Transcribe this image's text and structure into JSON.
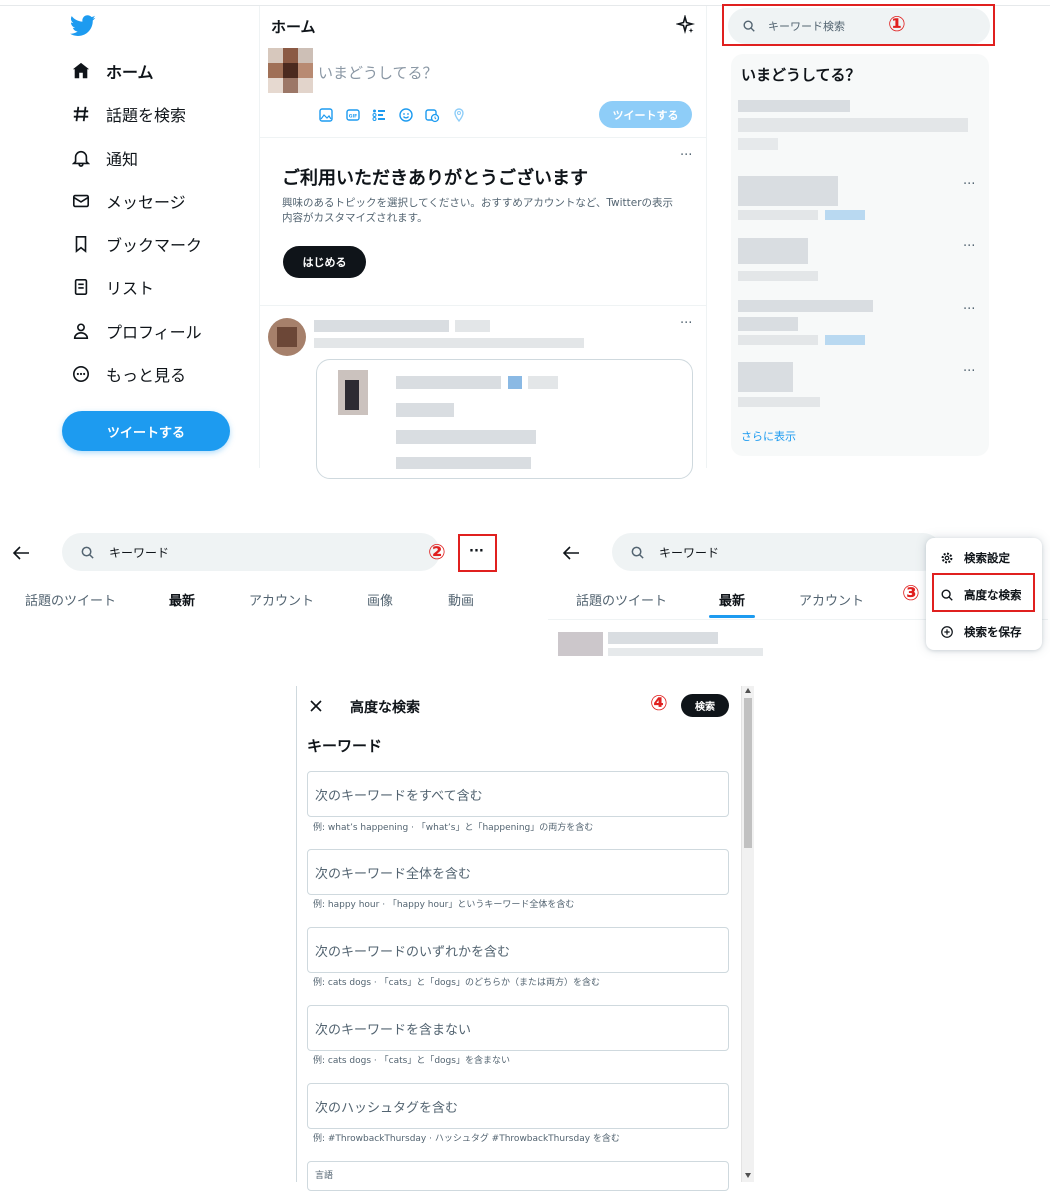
{
  "app": {
    "logo_icon": "twitter-bird-icon",
    "accent_color": "#1d9bf0",
    "annotation_color": "#e0201f"
  },
  "sidebar": {
    "items": [
      {
        "label": "ホーム",
        "icon": "home-icon",
        "active": true
      },
      {
        "label": "話題を検索",
        "icon": "hashtag-icon",
        "active": false
      },
      {
        "label": "通知",
        "icon": "bell-icon",
        "active": false
      },
      {
        "label": "メッセージ",
        "icon": "envelope-icon",
        "active": false
      },
      {
        "label": "ブックマーク",
        "icon": "bookmark-icon",
        "active": false
      },
      {
        "label": "リスト",
        "icon": "list-icon",
        "active": false
      },
      {
        "label": "プロフィール",
        "icon": "person-icon",
        "active": false
      },
      {
        "label": "もっと見る",
        "icon": "more-circle-icon",
        "active": false
      }
    ],
    "tweet_button": "ツイートする"
  },
  "home": {
    "title": "ホーム",
    "compose_placeholder": "いまどうしてる？",
    "compose_button": "ツイートする",
    "compose_tools": [
      "image-icon",
      "gif-icon",
      "poll-icon",
      "emoji-icon",
      "schedule-icon",
      "location-icon"
    ],
    "welcome": {
      "title": "ご利用いただきありがとうございます",
      "description": "興味のあるトピックを選択してください。おすすめアカウントなど、Twitterの表示内容がカスタマイズされます。",
      "button": "はじめる"
    }
  },
  "right_panel": {
    "search_placeholder": "キーワード検索",
    "trends_title": "いまどうしてる？",
    "show_more": "さらに表示"
  },
  "annotations": {
    "step1": "①",
    "step2": "②",
    "step3": "③",
    "step4": "④"
  },
  "search_results": {
    "query": "キーワード",
    "tabs": [
      "話題のツイート",
      "最新",
      "アカウント",
      "画像",
      "動画"
    ],
    "active_tab": "最新",
    "menu": [
      {
        "label": "検索設定",
        "icon": "gear-icon"
      },
      {
        "label": "高度な検索",
        "icon": "search-icon"
      },
      {
        "label": "検索を保存",
        "icon": "plus-circle-icon"
      }
    ]
  },
  "advanced_search": {
    "title": "高度な検索",
    "search_button": "検索",
    "section_heading": "キーワード",
    "fields": [
      {
        "placeholder": "次のキーワードをすべて含む",
        "hint": "例: what’s happening · 「what’s」と「happening」の両方を含む"
      },
      {
        "placeholder": "次のキーワード全体を含む",
        "hint": "例: happy hour · 「happy hour」というキーワード全体を含む"
      },
      {
        "placeholder": "次のキーワードのいずれかを含む",
        "hint": "例: cats dogs · 「cats」と「dogs」のどちらか（または両方）を含む"
      },
      {
        "placeholder": "次のキーワードを含まない",
        "hint": "例: cats dogs · 「cats」と「dogs」を含まない"
      },
      {
        "placeholder": "次のハッシュタグを含む",
        "hint": "例: #ThrowbackThursday · ハッシュタグ #ThrowbackThursday を含む"
      }
    ],
    "language_label": "言語"
  }
}
